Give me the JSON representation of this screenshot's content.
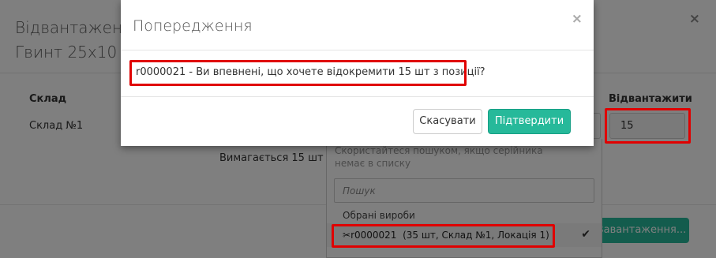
{
  "page": {
    "title_line1": "Відвантаження",
    "title_line2": "Гвинт 25х10 у",
    "close_icon": "×",
    "table": {
      "warehouse_header": "Склад",
      "warehouse_value": "Склад №1",
      "ship_header": "Відвантажити",
      "ship_value": "15"
    },
    "required_text": "Вимагається 15 шт",
    "ship_button_label": "Вавантаження..."
  },
  "dropdown": {
    "hint": "Скористайтеся пошуком, якщо серійника немає в списку",
    "search_placeholder": "Пошук",
    "group_label": "Обрані вироби",
    "selected_item": {
      "icon_glyph": "✂",
      "code": "r0000021",
      "details": "(35 шт, Склад №1, Локація 1)",
      "check_glyph": "✔"
    }
  },
  "modal": {
    "title": "Попередження",
    "close_icon": "×",
    "message": "r0000021 - Ви впевнені, що хочете відокремити 15 шт з позиції?",
    "cancel_label": "Скасувати",
    "confirm_label": "Підтвердити"
  },
  "colors": {
    "accent": "#26b99a",
    "highlight": "#e00000",
    "overlay": "rgba(0,0,0,0.5)"
  }
}
